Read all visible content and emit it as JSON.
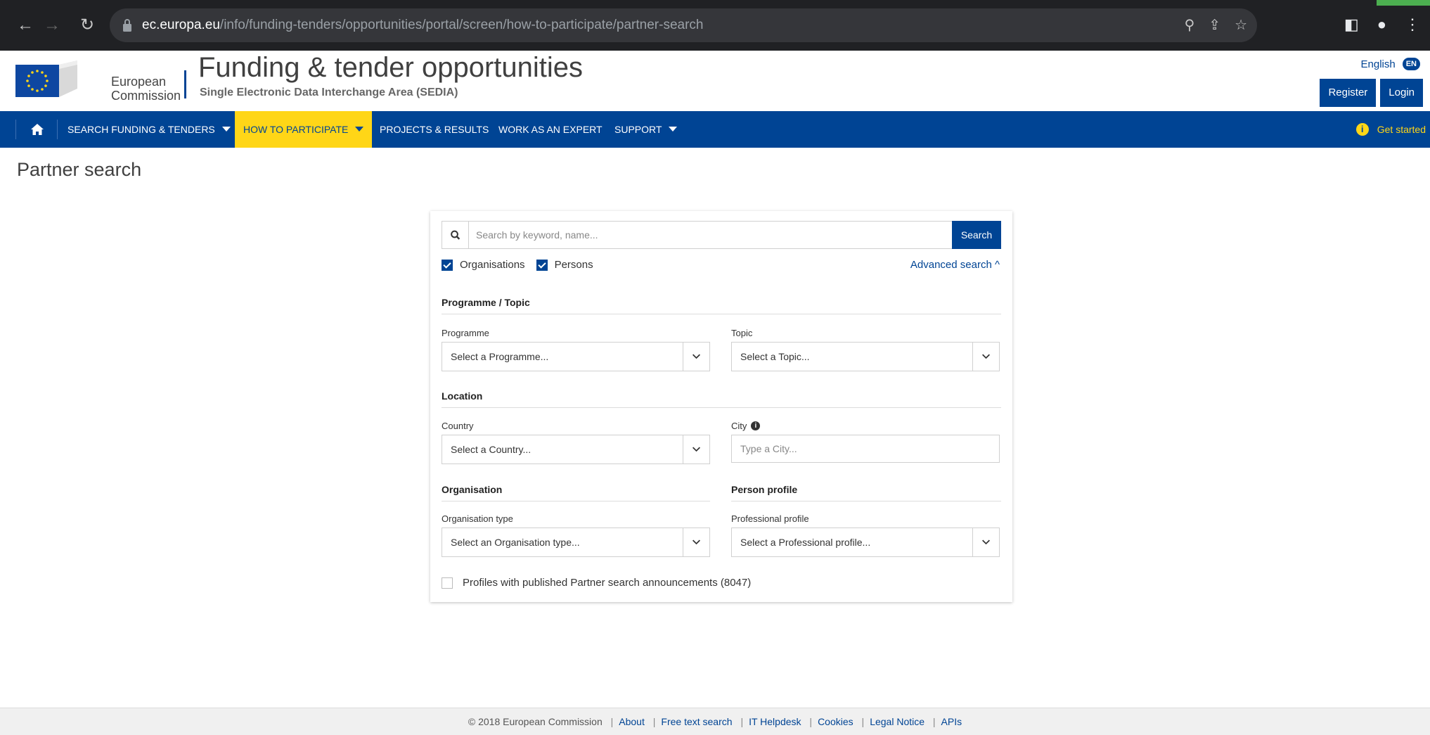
{
  "browser": {
    "url_host": "ec.europa.eu",
    "url_path": "/info/funding-tenders/opportunities/portal/screen/how-to-participate/partner-search"
  },
  "header": {
    "org_line1": "European",
    "org_line2": "Commission",
    "title": "Funding & tender opportunities",
    "subtitle": "Single Electronic Data Interchange Area (SEDIA)",
    "language": "English",
    "language_code": "EN",
    "register": "Register",
    "login": "Login"
  },
  "nav": {
    "items": [
      {
        "label": "SEARCH FUNDING & TENDERS"
      },
      {
        "label": "HOW TO PARTICIPATE"
      },
      {
        "label": "PROJECTS & RESULTS"
      },
      {
        "label": "WORK AS AN EXPERT"
      },
      {
        "label": "SUPPORT"
      }
    ],
    "get_started": "Get started"
  },
  "page": {
    "title": "Partner search"
  },
  "search": {
    "placeholder": "Search by keyword, name...",
    "button": "Search",
    "organisations": "Organisations",
    "persons": "Persons",
    "advanced": "Advanced search ^"
  },
  "sections": {
    "programme_topic": "Programme / Topic",
    "location": "Location",
    "organisation": "Organisation",
    "person_profile": "Person profile"
  },
  "fields": {
    "programme": {
      "label": "Programme",
      "value": "Select a Programme..."
    },
    "topic": {
      "label": "Topic",
      "value": "Select a Topic..."
    },
    "country": {
      "label": "Country",
      "value": "Select a Country..."
    },
    "city": {
      "label": "City",
      "placeholder": "Type a City..."
    },
    "org_type": {
      "label": "Organisation type",
      "value": "Select an Organisation type..."
    },
    "prof_profile": {
      "label": "Professional profile",
      "value": "Select a Professional profile..."
    }
  },
  "announcements": "Profiles with published Partner search announcements (8047)",
  "footer": {
    "copyright": "© 2018 European Commission",
    "links": [
      "About",
      "Free text search",
      "IT Helpdesk",
      "Cookies",
      "Legal Notice",
      "APIs"
    ]
  },
  "colors": {
    "brand_blue": "#004494",
    "accent_yellow": "#ffd617"
  }
}
